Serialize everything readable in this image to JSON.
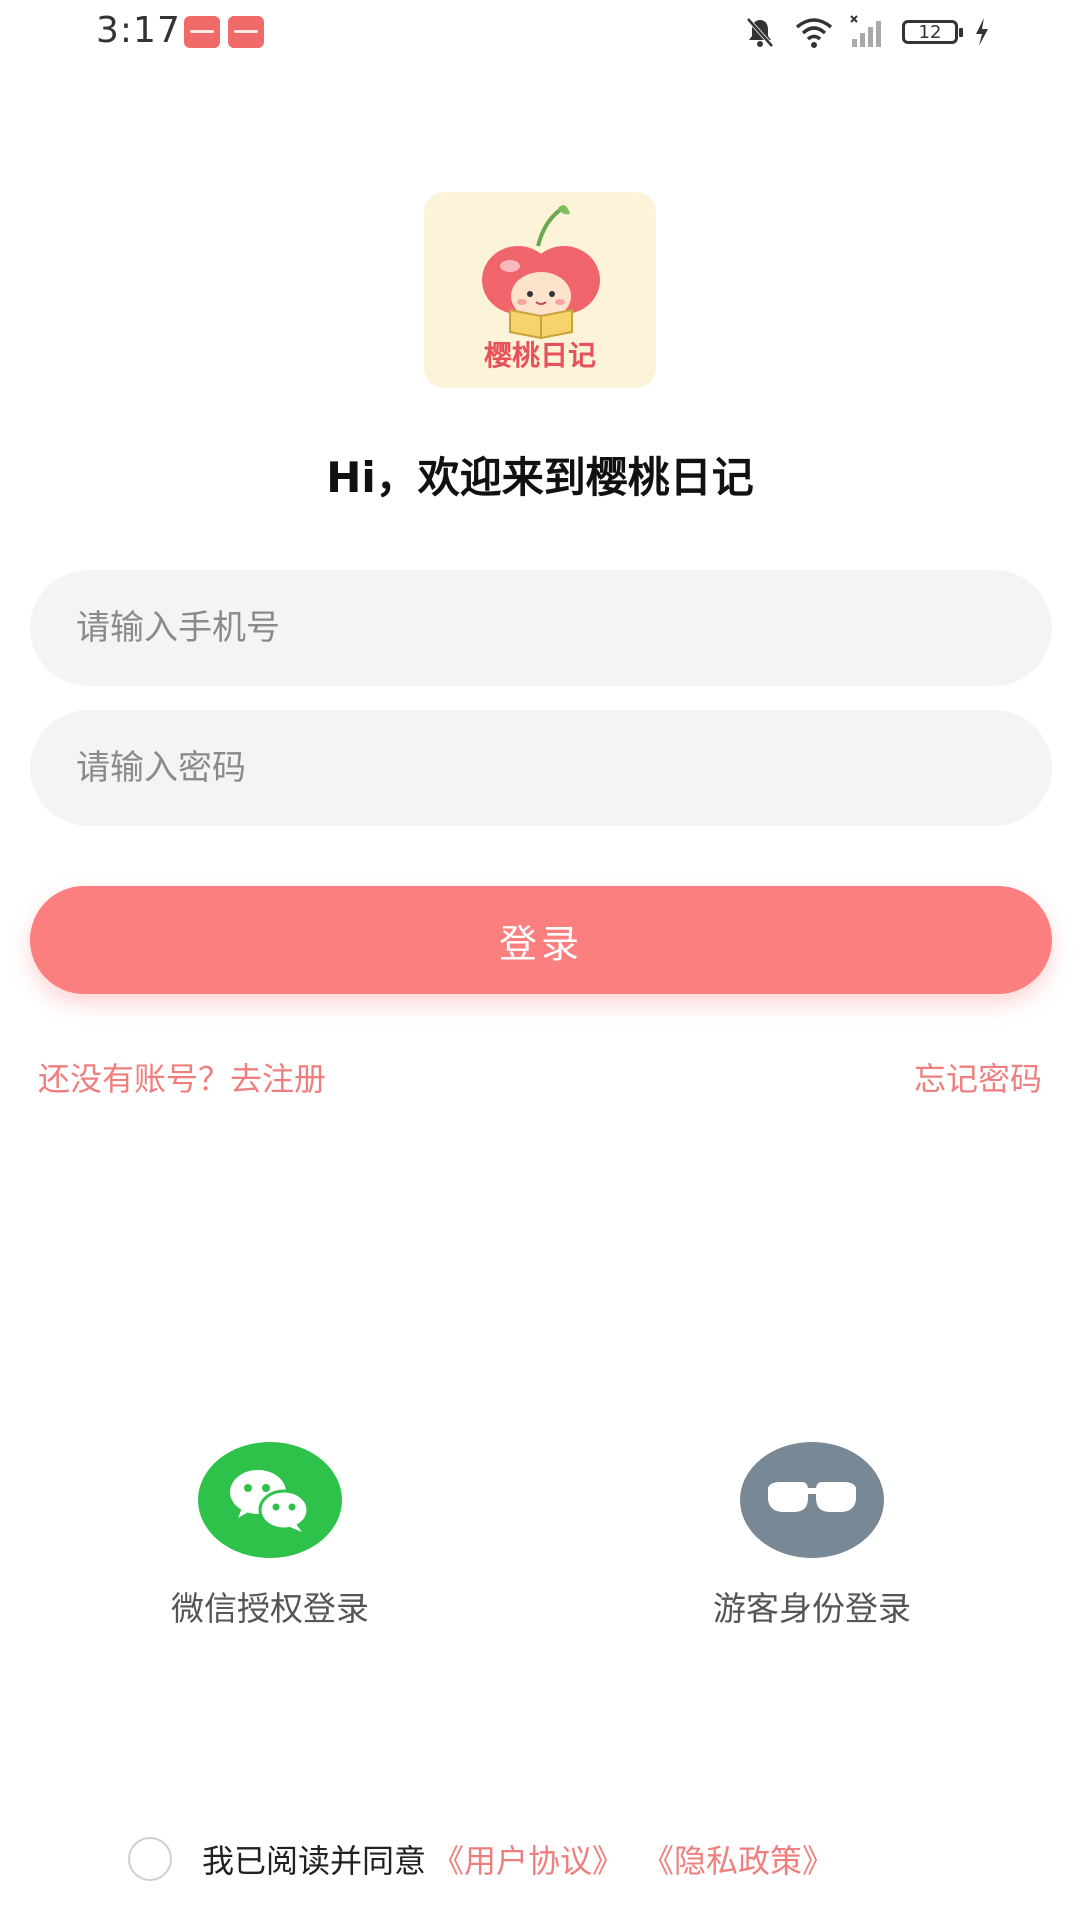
{
  "status_bar": {
    "time": "3:17",
    "battery": "12"
  },
  "logo": {
    "text": "樱桃日记"
  },
  "welcome": "Hi，欢迎来到樱桃日记",
  "form": {
    "phone_placeholder": "请输入手机号",
    "password_placeholder": "请输入密码",
    "login_label": "登录"
  },
  "links": {
    "register": "还没有账号？去注册",
    "forgot": "忘记密码"
  },
  "social": {
    "wechat_label": "微信授权登录",
    "guest_label": "游客身份登录"
  },
  "agreement": {
    "text": "我已阅读并同意",
    "user_agreement": "《用户协议》",
    "privacy_policy": "《隐私政策》"
  },
  "colors": {
    "accent": "#fb7f7f",
    "link": "#ef7f7f",
    "wechat": "#2fc24a",
    "guest": "#788894",
    "logo_bg": "#fdf3d9"
  }
}
